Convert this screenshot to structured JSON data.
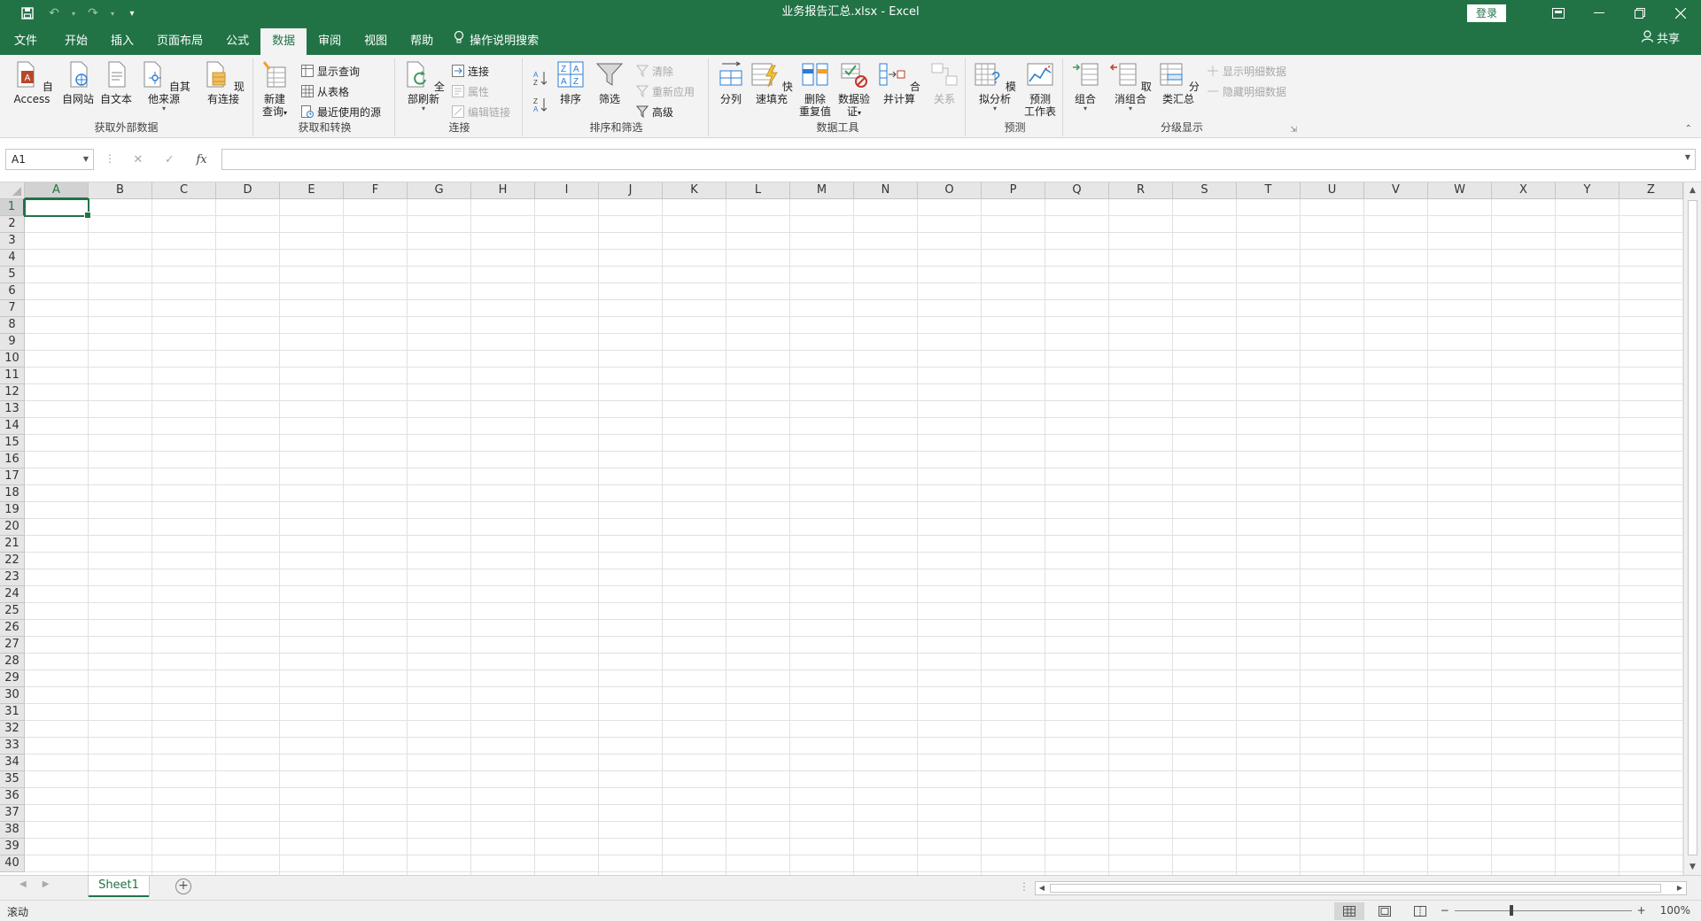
{
  "window": {
    "title": "业务报告汇总.xlsx  -  Excel",
    "login_label": "登录"
  },
  "ribbon_tabs": [
    {
      "label": "文件"
    },
    {
      "label": "开始"
    },
    {
      "label": "插入"
    },
    {
      "label": "页面布局"
    },
    {
      "label": "公式"
    },
    {
      "label": "数据"
    },
    {
      "label": "审阅"
    },
    {
      "label": "视图"
    },
    {
      "label": "帮助"
    }
  ],
  "tell_me": "操作说明搜索",
  "share": "共享",
  "ribbon": {
    "get_external": {
      "label": "获取外部数据",
      "access": "自 Access",
      "web": "自网站",
      "text": "自文本",
      "other": "自其他来源",
      "existing": "现有连接"
    },
    "get_transform": {
      "label": "获取和转换",
      "new_query_1": "新建",
      "new_query_2": "查询",
      "show_queries": "显示查询",
      "from_table": "从表格",
      "recent_sources": "最近使用的源"
    },
    "connections": {
      "label": "连接",
      "refresh_all": "全部刷新",
      "connections": "连接",
      "properties": "属性",
      "edit_links": "编辑链接"
    },
    "sort_filter": {
      "label": "排序和筛选",
      "sort": "排序",
      "filter": "筛选",
      "clear": "清除",
      "reapply": "重新应用",
      "advanced": "高级"
    },
    "data_tools": {
      "label": "数据工具",
      "text_to_columns": "分列",
      "flash_fill": "快速填充",
      "remove_dup_1": "删除",
      "remove_dup_2": "重复值",
      "validation_1": "数据验",
      "validation_2": "证",
      "consolidate": "合并计算",
      "relationships": "关系"
    },
    "forecast": {
      "label": "预测",
      "what_if": "模拟分析",
      "forecast_sheet_1": "预测",
      "forecast_sheet_2": "工作表"
    },
    "outline": {
      "label": "分级显示",
      "group": "组合",
      "ungroup": "取消组合",
      "subtotal": "分类汇总",
      "show_detail": "显示明细数据",
      "hide_detail": "隐藏明细数据"
    }
  },
  "formula_bar": {
    "name_box": "A1",
    "formula": "",
    "fx": "fx"
  },
  "grid": {
    "columns": [
      "A",
      "B",
      "C",
      "D",
      "E",
      "F",
      "G",
      "H",
      "I",
      "J",
      "K",
      "L",
      "M",
      "N",
      "O",
      "P",
      "Q",
      "R",
      "S",
      "T",
      "U",
      "V",
      "W",
      "X",
      "Y",
      "Z"
    ],
    "rows": [
      "1",
      "2",
      "3",
      "4",
      "5",
      "6",
      "7",
      "8",
      "9",
      "10",
      "11",
      "12",
      "13",
      "14",
      "15",
      "16",
      "17",
      "18",
      "19",
      "20",
      "21",
      "22",
      "23",
      "24",
      "25",
      "26",
      "27",
      "28",
      "29",
      "30",
      "31",
      "32",
      "33",
      "34",
      "35",
      "36",
      "37",
      "38",
      "39",
      "40"
    ],
    "selected_column": "A",
    "selected_row": "1"
  },
  "sheets": [
    {
      "label": "Sheet1"
    }
  ],
  "status": {
    "mode": "滚动",
    "zoom": "100%"
  },
  "colors": {
    "accent": "#217346"
  }
}
